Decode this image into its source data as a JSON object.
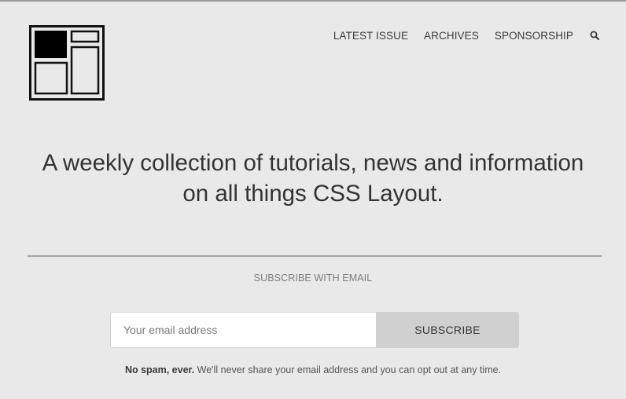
{
  "nav": {
    "items": [
      {
        "label": "LATEST ISSUE"
      },
      {
        "label": "ARCHIVES"
      },
      {
        "label": "SPONSORSHIP"
      }
    ],
    "search_icon": "search-icon"
  },
  "logo": {
    "icon": "layout-grid-logo"
  },
  "hero": {
    "tagline_line1": "A weekly collection of tutorials, news and information",
    "tagline_line2": "on all things CSS Layout."
  },
  "subscribe": {
    "heading": "SUBSCRIBE WITH EMAIL",
    "email_placeholder": "Your email address",
    "email_value": "",
    "button_label": "SUBSCRIBE",
    "note_bold": "No spam, ever.",
    "note_rest": " We'll never share your email address and you can opt out at any time."
  },
  "colors": {
    "background": "#e9e9e9",
    "text": "#333333",
    "button_bg": "#d0d0d0",
    "input_bg": "#ffffff",
    "divider": "#a3a3a3"
  }
}
